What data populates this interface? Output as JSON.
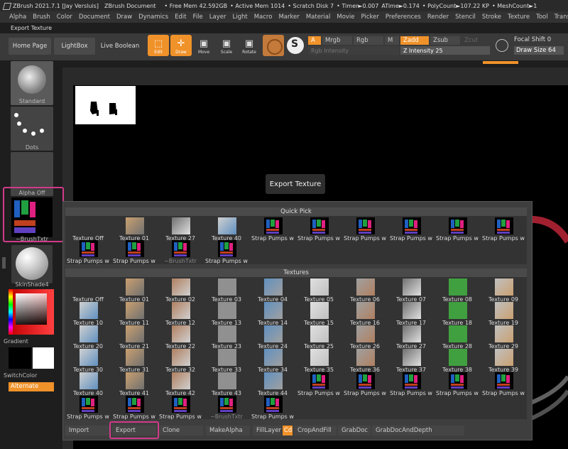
{
  "titlebar": {
    "app": "ZBrush 2021.7.1 [Jay Versluis]",
    "doc": "ZBrush Document",
    "free_mem": "• Free Mem 42.592GB",
    "active_mem": "• Active Mem 1014",
    "scratch": "• Scratch Disk 7",
    "timer": "• Timer►0.007",
    "atime": "ATime►0.174",
    "poly": "• PolyCount►107.22 KP",
    "mesh": "• MeshCount►1"
  },
  "menu": [
    "Alpha",
    "Brush",
    "Color",
    "Document",
    "Draw",
    "Dynamics",
    "Edit",
    "File",
    "Layer",
    "Light",
    "Macro",
    "Marker",
    "Material",
    "Movie",
    "Picker",
    "Preferences",
    "Render",
    "Stencil",
    "Stroke",
    "Texture",
    "Tool",
    "Transform"
  ],
  "subtitle": "Export Texture",
  "toolbar": {
    "home": "Home Page",
    "lightbox": "LightBox",
    "liveboolean": "Live Boolean",
    "edit": "Edit",
    "draw": "Draw",
    "move": "Move",
    "scale": "Scale",
    "rotate": "Rotate",
    "a": "A",
    "mrgb": "Mrgb",
    "rgb": "Rgb",
    "m": "M",
    "zadd": "Zadd",
    "zsub": "Zsub",
    "zcut": "Zcut",
    "rgb_intensity": "Rgb Intensity",
    "z_intensity": "Z Intensity 25",
    "focal_shift": "Focal Shift 0",
    "draw_size": "Draw Size 64"
  },
  "left": {
    "standard": "Standard",
    "dots": "Dots",
    "alpha_off": "Alpha Off",
    "brushtxtr": "~BrushTxtr",
    "skinshade": "SkinShade4",
    "gradient": "Gradient",
    "switchcolor": "SwitchColor",
    "alternate": "Alternate"
  },
  "tooltip": "Export Texture",
  "quick_pick": {
    "title": "Quick Pick",
    "items": [
      "Texture Off",
      "Texture 01",
      "Texture 27",
      "Texture 40",
      "Strap Pumps witl",
      "Strap Pumps witl",
      "Strap Pumps witl",
      "Strap Pumps witl",
      "Strap Pumps witl",
      "Strap Pumps witl",
      "Strap Pumps witl",
      "Strap Pumps witl",
      "~BrushTxtr",
      "Strap Pumps witl"
    ]
  },
  "textures": {
    "title": "Textures",
    "items": [
      "Texture Off",
      "Texture 01",
      "Texture 02",
      "Texture 03",
      "Texture 04",
      "Texture 05",
      "Texture 06",
      "Texture 07",
      "Texture 08",
      "Texture 09",
      "Texture 10",
      "Texture 11",
      "Texture 12",
      "Texture 13",
      "Texture 14",
      "Texture 15",
      "Texture 16",
      "Texture 17",
      "Texture 18",
      "Texture 19",
      "Texture 20",
      "Texture 21",
      "Texture 22",
      "Texture 23",
      "Texture 24",
      "Texture 25",
      "Texture 26",
      "Texture 27",
      "Texture 28",
      "Texture 29",
      "Texture 30",
      "Texture 31",
      "Texture 32",
      "Texture 33",
      "Texture 34",
      "Texture 35",
      "Texture 36",
      "Texture 37",
      "Texture 38",
      "Texture 39",
      "Texture 40",
      "Texture 41",
      "Texture 42",
      "Texture 43",
      "Texture 44",
      "Strap Pumps witl",
      "Strap Pumps witl",
      "Strap Pumps witl",
      "Strap Pumps witl",
      "Strap Pumps witl",
      "Strap Pumps witl",
      "Strap Pumps witl",
      "Strap Pumps witl",
      "~BrushTxtr",
      "Strap Pumps witl"
    ]
  },
  "buttons": {
    "import": "Import",
    "export": "Export",
    "clone": "Clone",
    "makealpha": "MakeAlpha",
    "filllayer": "FillLayer",
    "cd": "Cd",
    "cropandfill": "CropAndFill",
    "grabdoc": "GrabDoc",
    "grabdocanddepth": "GrabDocAndDepth"
  }
}
